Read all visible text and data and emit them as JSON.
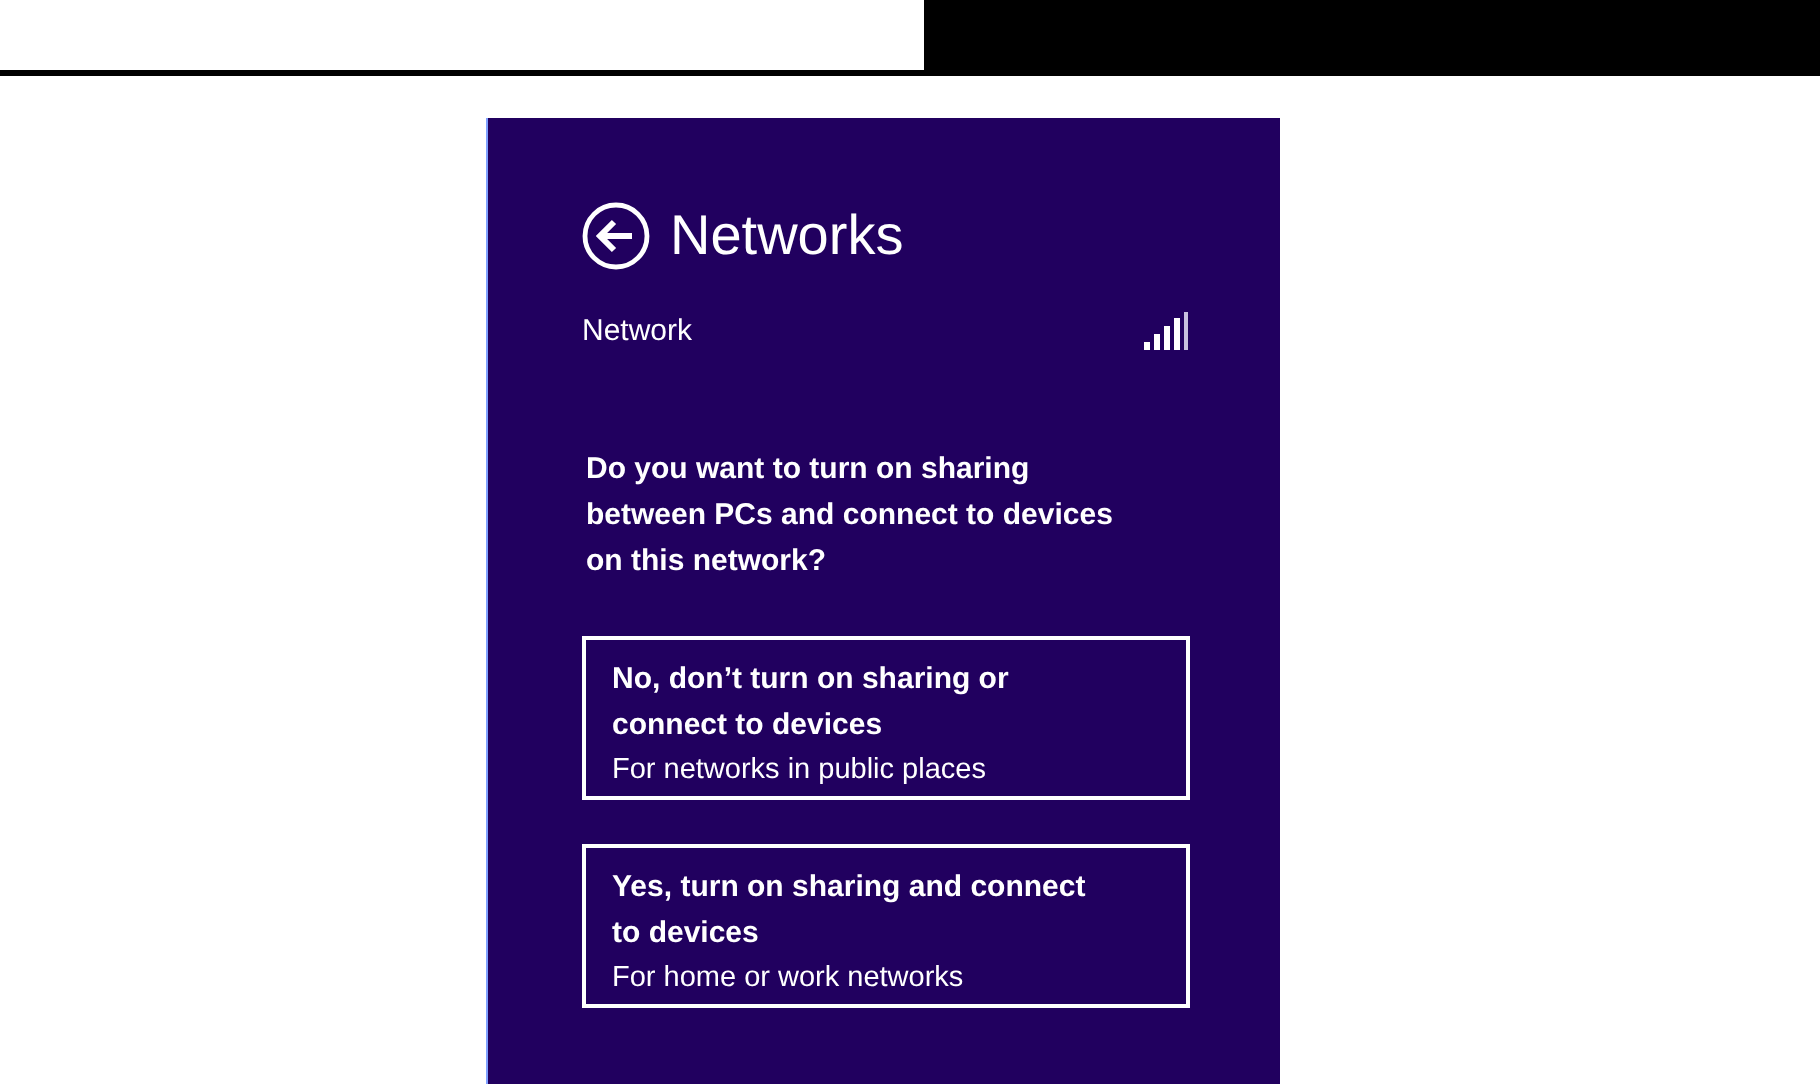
{
  "panel": {
    "title": "Networks"
  },
  "network": {
    "name": "Network"
  },
  "question": "Do you want to turn on sharing between PCs and connect to devices on this network?",
  "options": [
    {
      "title": "No, don’t turn on sharing or connect to devices",
      "subtitle": "For networks in public places"
    },
    {
      "title": "Yes, turn on sharing and connect to devices",
      "subtitle": "For home or work networks"
    }
  ]
}
